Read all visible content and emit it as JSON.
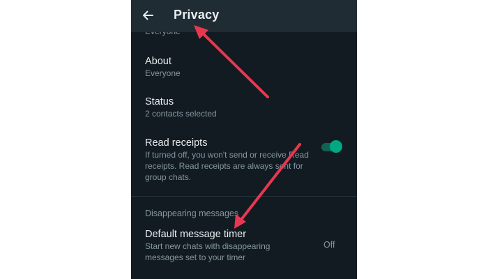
{
  "header": {
    "back_icon": "arrow-left-icon",
    "title": "Privacy"
  },
  "partial_row": {
    "subtitle": "Everyone"
  },
  "about": {
    "title": "About",
    "subtitle": "Everyone"
  },
  "status": {
    "title": "Status",
    "subtitle": "2 contacts selected"
  },
  "read_receipts": {
    "title": "Read receipts",
    "line1": "If turned off, you won't send or receive Read",
    "line2": "receipts. Read receipts are always sent for",
    "line3": "group chats.",
    "enabled": true
  },
  "disappearing": {
    "section_title": "Disappearing messages",
    "timer_title": "Default message timer",
    "timer_line1": "Start new chats with disappearing",
    "timer_line2": "messages set to your timer",
    "timer_value": "Off"
  },
  "colors": {
    "background": "#121b22",
    "appbar": "#1f2c34",
    "accent": "#00a884",
    "annotation_arrow": "#e8384f"
  }
}
